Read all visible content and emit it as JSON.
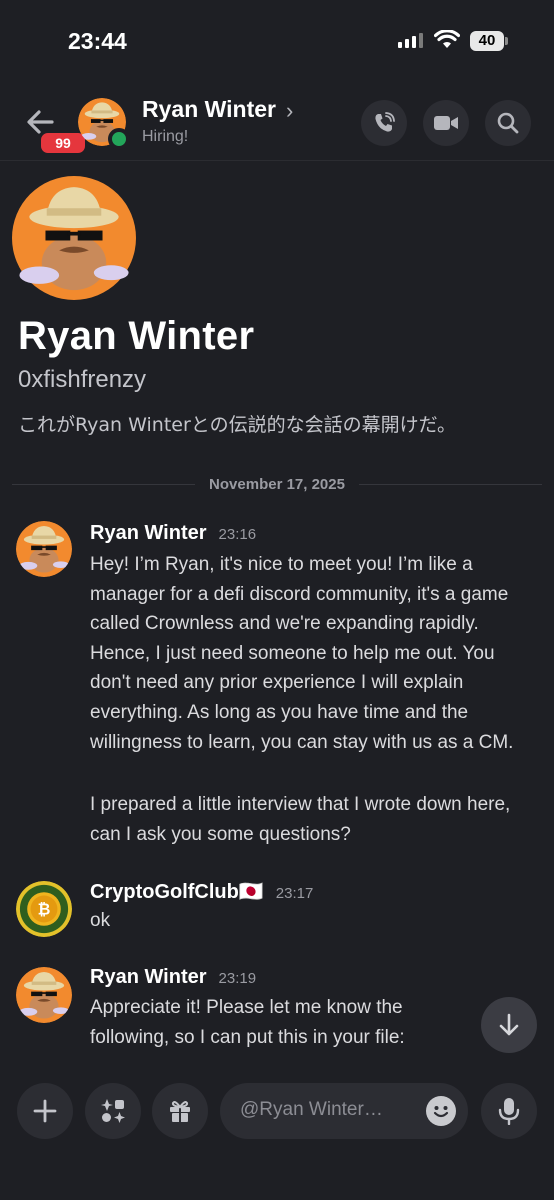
{
  "status_bar": {
    "time": "23:44",
    "battery": "40"
  },
  "header": {
    "back_badge": "99",
    "name": "Ryan Winter",
    "chevron": "›",
    "status": "Hiring!",
    "icons": [
      "back-arrow-icon",
      "phone-call-icon",
      "video-camera-icon",
      "search-icon"
    ]
  },
  "intro": {
    "name": "Ryan Winter",
    "username": "0xfishfrenzy",
    "description": "これがRyan Winterとの伝説的な会話の幕開けだ。"
  },
  "date_separator": "November 17, 2025",
  "messages": [
    {
      "author": "Ryan Winter",
      "time": "23:16",
      "text": "Hey! I’m Ryan, it's nice to meet you! I’m like a manager for a defi discord community, it's a game called Crownless and we're expanding rapidly. Hence, I just need someone to help me out. You don't need any prior experience I will explain everything. As long as you have time and the willingness to learn, you can stay with us as a CM.",
      "text2": "I prepared a little interview that I wrote down here, can I ask you some questions?"
    },
    {
      "author": "CryptoGolfClub🇯🇵",
      "time": "23:17",
      "text": "ok"
    },
    {
      "author": "Ryan Winter",
      "time": "23:19",
      "text": "Appreciate it! Please let me know the following, so I can put this in your file:"
    }
  ],
  "composer": {
    "placeholder": "@Ryan Winter…",
    "icons": [
      "plus-icon",
      "apps-icon",
      "gift-icon",
      "emoji-icon",
      "microphone-icon"
    ]
  },
  "colors": {
    "background": "#1e1f24",
    "button": "#2c2d33",
    "badge": "#e5363d",
    "online": "#23a55a",
    "avatar_orange": "#f28a2e"
  }
}
